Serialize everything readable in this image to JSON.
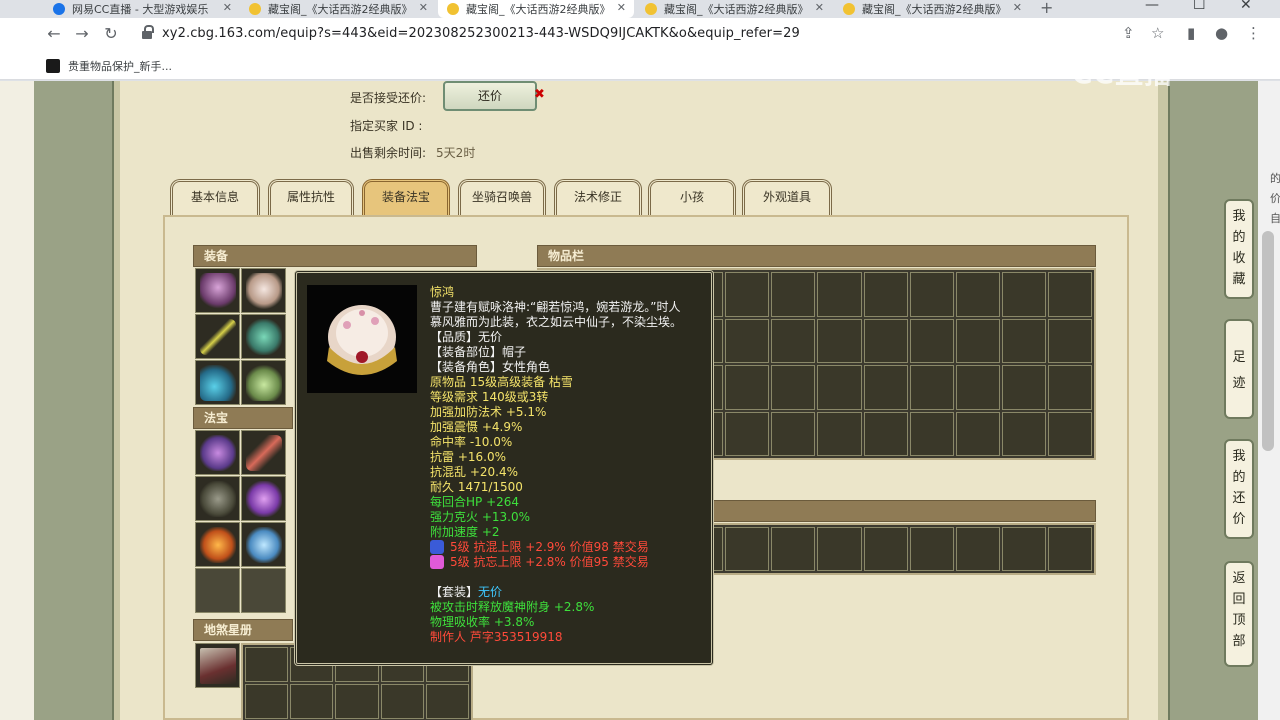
{
  "browser": {
    "tabs": [
      {
        "label": "网易CC直播 - 大型游戏娱乐",
        "active": false,
        "color": "#1a73e8"
      },
      {
        "label": "藏宝阁_《大话西游2经典版》",
        "active": false,
        "color": "#f1c232"
      },
      {
        "label": "藏宝阁_《大话西游2经典版》",
        "active": true,
        "color": "#f1c232"
      },
      {
        "label": "藏宝阁_《大话西游2经典版》",
        "active": false,
        "color": "#f1c232"
      },
      {
        "label": "藏宝阁_《大话西游2经典版》",
        "active": false,
        "color": "#f1c232"
      }
    ],
    "url": "xy2.cbg.163.com/equip?s=443&eid=202308252300213-443-WSDQ9IJCAKTK&o&equip_refer=29",
    "bookmark": "贵重物品保护_新手...",
    "watermark": "CC直播"
  },
  "listing": {
    "accept_counter_label": "是否接受还价:",
    "counter_button": "还价",
    "buyer_id_label": "指定买家 ID :",
    "time_left_label": "出售剩余时间:",
    "time_left_value": "5天2时"
  },
  "tabs": [
    "基本信息",
    "属性抗性",
    "装备法宝",
    "坐骑召唤兽",
    "法术修正",
    "小孩",
    "外观道具"
  ],
  "active_tab": 2,
  "sections": {
    "equipment": "装备",
    "magic_treasure": "法宝",
    "star_book": "地煞星册",
    "inventory": "物品栏"
  },
  "tooltip": {
    "name": "惊鸿",
    "desc_line1": "曹子建有赋咏洛神:“翩若惊鸿，婉若游龙。”时人",
    "desc_line2": "慕风雅而为此装，衣之如云中仙子，不染尘埃。",
    "quality": "【品质】无价",
    "slot": "【装备部位】帽子",
    "role": "【装备角色】女性角色",
    "origin": "原物品 15级高级装备 枯雪",
    "level_req": "等级需求 140级或3转",
    "stats_white": [
      "加强加防法术 +5.1%",
      "加强震慑 +4.9%",
      "命中率 -10.0%",
      "抗雷 +16.0%",
      "抗混乱 +20.4%",
      "耐久 1471/1500"
    ],
    "stats_green": [
      "每回合HP +264",
      "强力克火 +13.0%",
      "附加速度 +2"
    ],
    "gems": [
      {
        "text": "5级 抗混上限 +2.9% 价值98 禁交易",
        "color": "#3a5bd8"
      },
      {
        "text": "5级 抗忘上限 +2.8% 价值95 禁交易",
        "color": "#e05ad8"
      }
    ],
    "set_label": "【套装】",
    "set_value": "无价",
    "set_stats": [
      "被攻击时释放魔神附身 +2.8%",
      "物理吸收率 +3.8%"
    ],
    "maker": "制作人 芦字353519918"
  },
  "side_buttons": [
    "我的收藏",
    "足迹",
    "我的还价",
    "返回顶部"
  ],
  "edge_text": [
    "的",
    "",
    "",
    "",
    "价",
    "自"
  ]
}
